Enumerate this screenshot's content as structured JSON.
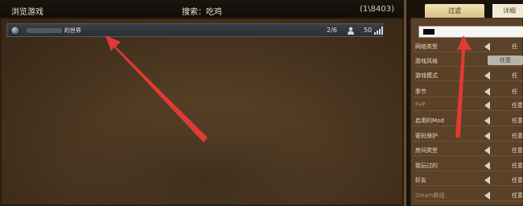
{
  "header": {
    "browse_title": "浏览游戏",
    "search_title": "搜索：吃鸡",
    "count": "(1\\8403)"
  },
  "server_row": {
    "name": "的世界",
    "players": "2/6",
    "ping": "50"
  },
  "tabs": {
    "filter": "过滤",
    "details": "详细"
  },
  "filters": [
    {
      "label": "网络类型",
      "value": "任"
    },
    {
      "label": "游戏风格",
      "value": "任意"
    },
    {
      "label": "游戏模式",
      "value": "任"
    },
    {
      "label": "季节",
      "value": "任"
    },
    {
      "label": "PvP",
      "value": "任意"
    },
    {
      "label": "启用的Mod",
      "value": "任意"
    },
    {
      "label": "密码保护",
      "value": "任意"
    },
    {
      "label": "房间类型",
      "value": "任意"
    },
    {
      "label": "我玩过的",
      "value": "任意"
    },
    {
      "label": "好友",
      "value": "任意"
    },
    {
      "label": "Steam群组",
      "value": "任意"
    }
  ],
  "colors": {
    "annotation_arrow": "#e03a34",
    "tab_active": "#e7d19f"
  }
}
